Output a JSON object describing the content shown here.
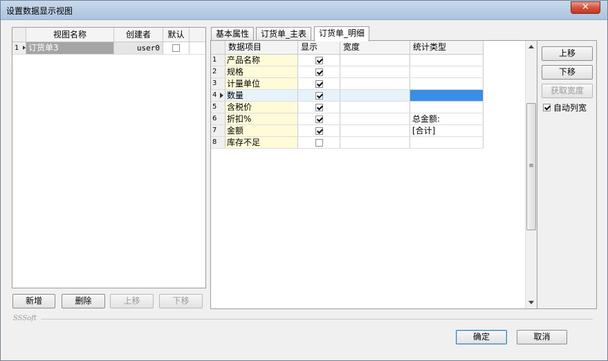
{
  "window": {
    "title": "设置数据显示视图",
    "close_glyph": "✕"
  },
  "left": {
    "headers": [
      "视图名称",
      "创建者",
      "默认"
    ],
    "rows": [
      {
        "num": "1",
        "name": "订货单3",
        "creator": "user0",
        "default": false
      }
    ],
    "buttons": {
      "add": "新增",
      "delete": "删除",
      "up": "上移",
      "down": "下移"
    }
  },
  "tabs": [
    "基本属性",
    "订货单_主表",
    "订货单_明细"
  ],
  "active_tab": 2,
  "grid": {
    "headers": [
      "数据项目",
      "显示",
      "宽度",
      "统计类型"
    ],
    "rows": [
      {
        "num": "1",
        "name": "产品名称",
        "show": true,
        "width": "",
        "stat": ""
      },
      {
        "num": "2",
        "name": "规格",
        "show": true,
        "width": "",
        "stat": ""
      },
      {
        "num": "3",
        "name": "计量单位",
        "show": true,
        "width": "",
        "stat": ""
      },
      {
        "num": "4",
        "name": "数量",
        "show": true,
        "width": "",
        "stat": "",
        "current": true
      },
      {
        "num": "5",
        "name": "含税价",
        "show": true,
        "width": "",
        "stat": ""
      },
      {
        "num": "6",
        "name": "折扣%",
        "show": true,
        "width": "",
        "stat": "总金额:"
      },
      {
        "num": "7",
        "name": "金额",
        "show": true,
        "width": "",
        "stat": "[合计]"
      },
      {
        "num": "8",
        "name": "库存不足",
        "show": false,
        "width": "",
        "stat": ""
      }
    ],
    "scroll_grip": "≡"
  },
  "side": {
    "up": "上移",
    "down": "下移",
    "get_width": "获取宽度",
    "auto_col_width": "自动列宽",
    "auto_col_width_checked": true
  },
  "footer": {
    "brand": "SSSoft",
    "ok": "确定",
    "cancel": "取消"
  }
}
